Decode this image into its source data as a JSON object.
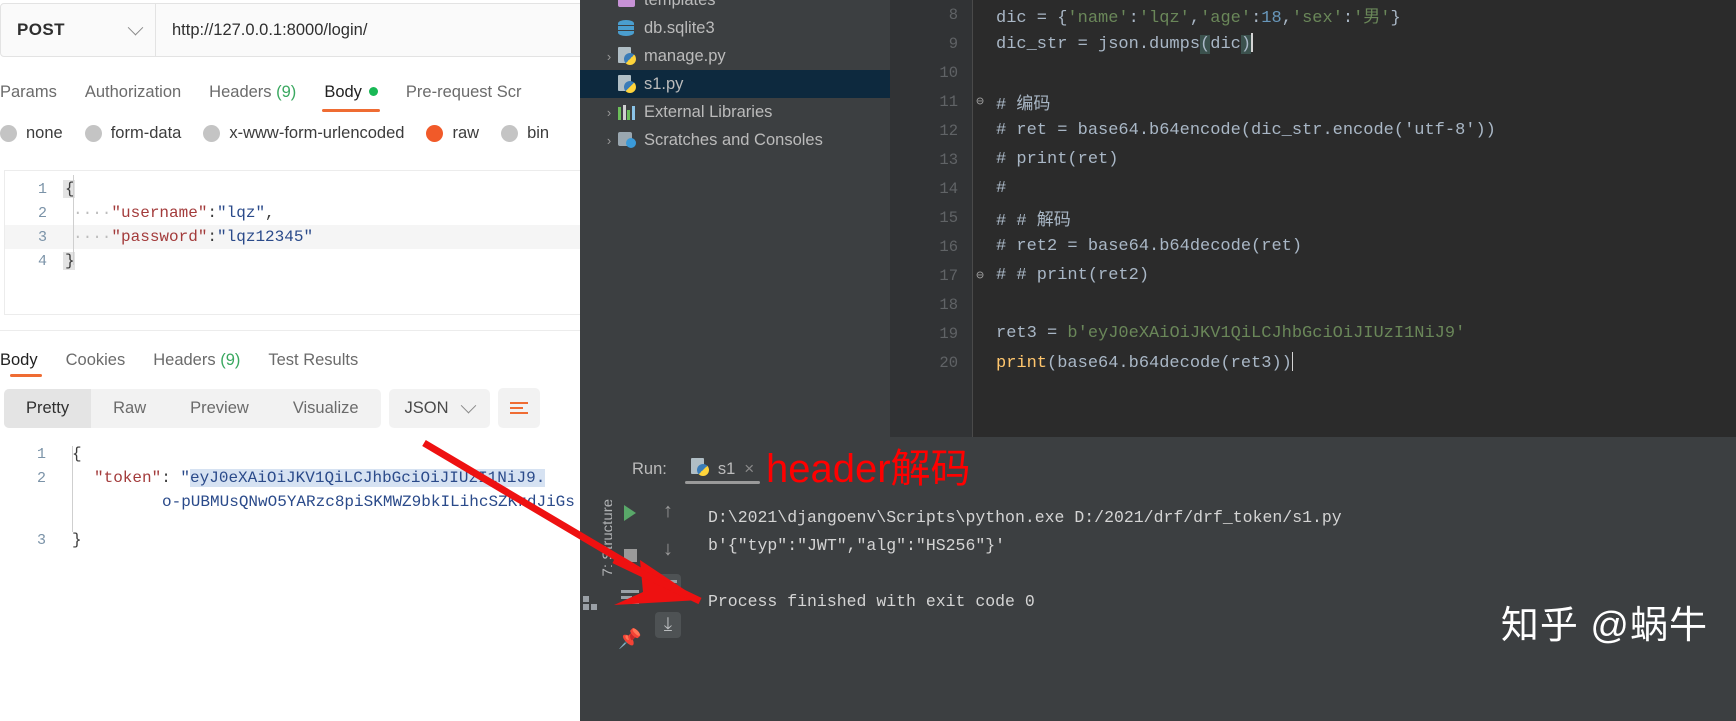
{
  "postman": {
    "method": "POST",
    "url": "http://127.0.0.1:8000/login/",
    "request_tabs": [
      {
        "label": "Params",
        "active": false
      },
      {
        "label": "Authorization",
        "active": false
      },
      {
        "label": "Headers",
        "count": "(9)",
        "active": false
      },
      {
        "label": "Body",
        "active": true,
        "dot": true
      },
      {
        "label": "Pre-request Scr",
        "active": false
      }
    ],
    "body_types": [
      {
        "label": "none",
        "selected": false
      },
      {
        "label": "form-data",
        "selected": false
      },
      {
        "label": "x-www-form-urlencoded",
        "selected": false
      },
      {
        "label": "raw",
        "selected": true
      },
      {
        "label": "bin",
        "selected": false
      }
    ],
    "request_body_lines": [
      {
        "n": "1",
        "indent": "",
        "text": "{"
      },
      {
        "n": "2",
        "indent": "····",
        "key": "\"username\"",
        "colon": ":",
        "value": "\"lqz\"",
        "comma": ","
      },
      {
        "n": "3",
        "indent": "····",
        "key": "\"password\"",
        "colon": ":",
        "value": "\"lqz12345\"",
        "comma": ""
      },
      {
        "n": "4",
        "indent": "",
        "text": "}"
      }
    ],
    "response_tabs": [
      {
        "label": "Body",
        "active": true
      },
      {
        "label": "Cookies",
        "active": false
      },
      {
        "label": "Headers",
        "count": "(9)",
        "active": false
      },
      {
        "label": "Test Results",
        "active": false
      }
    ],
    "view_modes": [
      {
        "label": "Pretty",
        "active": true
      },
      {
        "label": "Raw",
        "active": false
      },
      {
        "label": "Preview",
        "active": false
      },
      {
        "label": "Visualize",
        "active": false
      }
    ],
    "format_selected": "JSON",
    "response_body": {
      "line1_n": "1",
      "line1_text": "{",
      "line2_n": "2",
      "line2_key": "\"token\"",
      "line2_sep": ": ",
      "line2_quote": "\"",
      "line2_token": "eyJ0eXAiOiJKV1QiLCJhbGciOiJIUzI1NiJ9.",
      "line2b_token": "o-pUBMUsQNwO5YARzc8piSKMWZ9bkILihcSZKrdJiGs",
      "line3_n": "3",
      "line3_text": "}"
    }
  },
  "pycharm": {
    "tree": [
      {
        "label": "templates",
        "icon": "folder-icon",
        "arrow": "",
        "selected": false
      },
      {
        "label": "db.sqlite3",
        "icon": "database-icon",
        "arrow": "",
        "selected": false
      },
      {
        "label": "manage.py",
        "icon": "python-file-icon",
        "arrow": "›",
        "selected": false
      },
      {
        "label": "s1.py",
        "icon": "python-file-icon",
        "arrow": "",
        "selected": true
      },
      {
        "label": "External Libraries",
        "icon": "libraries-icon",
        "arrow": "›",
        "selected": false
      },
      {
        "label": "Scratches and Consoles",
        "icon": "scratches-icon",
        "arrow": "›",
        "selected": false
      }
    ],
    "editor_lines": [
      {
        "n": "8",
        "fold": "",
        "code": "dic = {'name':'lqz','age':18,'sex':'男'}"
      },
      {
        "n": "9",
        "fold": "",
        "code": "dic_str = json.dumps(dic)"
      },
      {
        "n": "10",
        "fold": "",
        "code": ""
      },
      {
        "n": "11",
        "fold": "⊖",
        "code": "# 编码"
      },
      {
        "n": "12",
        "fold": "",
        "code": "# ret = base64.b64encode(dic_str.encode('utf-8'))"
      },
      {
        "n": "13",
        "fold": "",
        "code": "# print(ret)"
      },
      {
        "n": "14",
        "fold": "",
        "code": "#"
      },
      {
        "n": "15",
        "fold": "",
        "code": "# # 解码"
      },
      {
        "n": "16",
        "fold": "",
        "code": "# ret2 = base64.b64decode(ret)"
      },
      {
        "n": "17",
        "fold": "⊖",
        "code": "# # print(ret2)"
      },
      {
        "n": "18",
        "fold": "",
        "code": ""
      },
      {
        "n": "19",
        "fold": "",
        "code": "ret3 = b'eyJ0eXAiOiJKV1QiLCJhbGciOiJIUzI1NiJ9'"
      },
      {
        "n": "20",
        "fold": "",
        "code": "print(base64.b64decode(ret3))"
      }
    ],
    "run_label": "Run:",
    "run_tab_name": "s1",
    "run_close": "×",
    "console_lines": [
      "D:\\2021\\djangoenv\\Scripts\\python.exe D:/2021/drf/drf_token/s1.py",
      "b'{\"typ\":\"JWT\",\"alg\":\"HS256\"}'",
      "",
      "Process finished with exit code 0"
    ],
    "structure_label": "7: Structure"
  },
  "annotation": {
    "text": "header解码",
    "color": "#ff0000"
  },
  "watermark": "知乎 @蜗牛",
  "colors": {
    "postman_accent": "#ef6c33",
    "raw_radio": "#f15a29",
    "green_dot": "#19b855",
    "ide_bg": "#3c3f41",
    "editor_bg": "#2b2b2b",
    "tree_sel": "#0d293e"
  }
}
